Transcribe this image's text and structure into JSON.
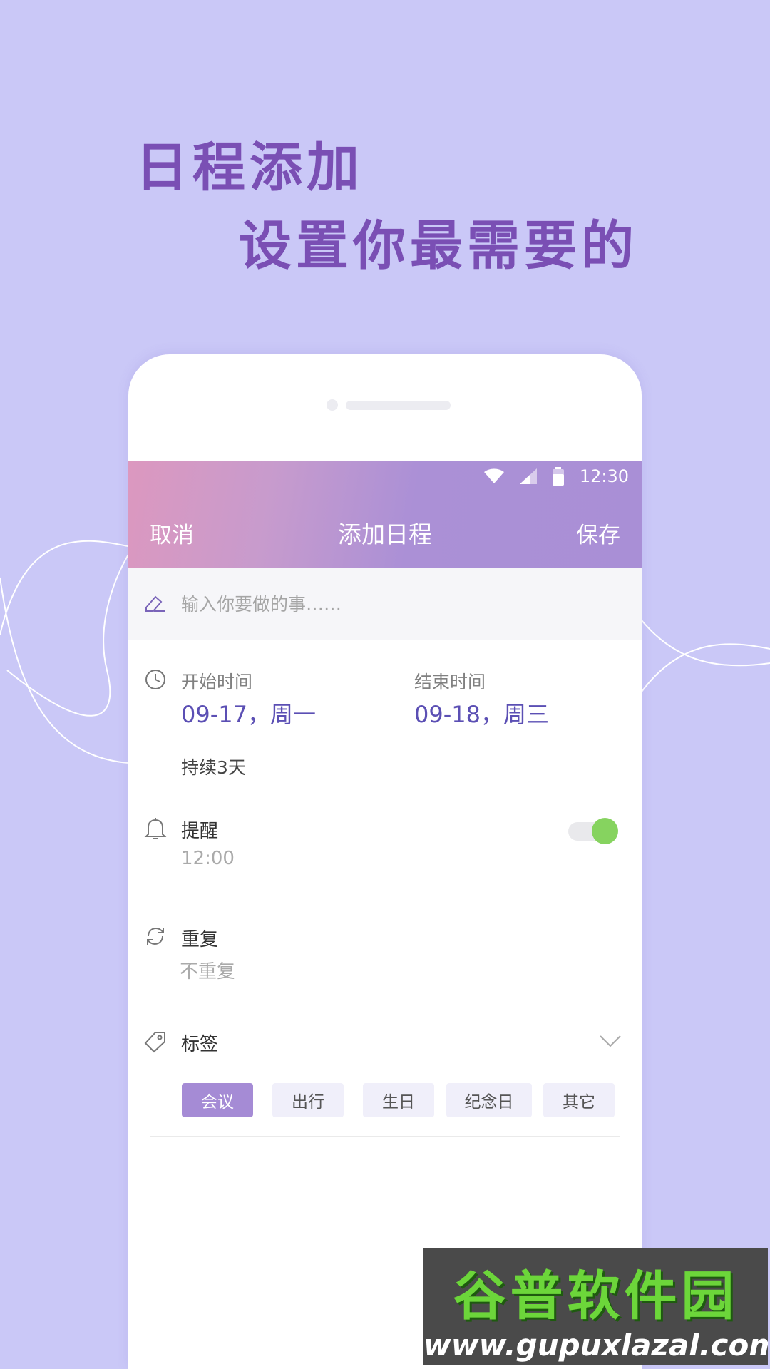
{
  "promo": {
    "line1": "日程添加",
    "line2": "设置你最需要的"
  },
  "status_bar": {
    "time": "12:30"
  },
  "nav": {
    "cancel": "取消",
    "title": "添加日程",
    "save": "保存"
  },
  "task": {
    "placeholder": "输入你要做的事……"
  },
  "time": {
    "start_label": "开始时间",
    "start_value": "09-17，周一",
    "end_label": "结束时间",
    "end_value": "09-18，周三",
    "duration": "持续3天"
  },
  "reminder": {
    "label": "提醒",
    "time": "12:00",
    "enabled": true
  },
  "repeat": {
    "label": "重复",
    "value": "不重复"
  },
  "tags": {
    "label": "标签",
    "items": [
      "会议",
      "出行",
      "生日",
      "纪念日",
      "其它"
    ],
    "selected": "会议"
  },
  "watermark": {
    "top": "谷普软件园",
    "bottom": "www.gupuxlazal.com"
  },
  "colors": {
    "background": "#cac8f7",
    "accent": "#7a4fb4",
    "value_blue": "#5b4fb4",
    "toggle_on": "#86d35f",
    "chip_active": "#a58bd5"
  }
}
